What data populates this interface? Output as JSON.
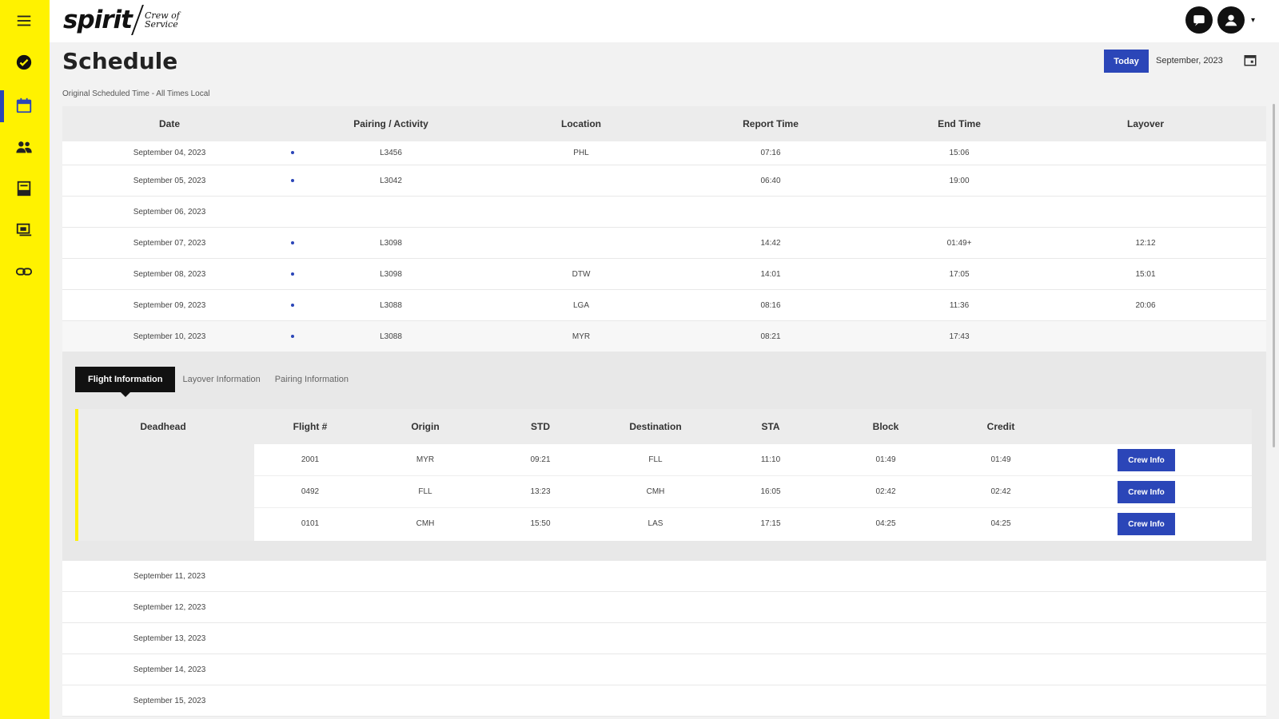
{
  "app": {
    "logo_word": "spirit",
    "logo_sub": "Crew of Service"
  },
  "page": {
    "title": "Schedule",
    "subnote": "Original Scheduled Time - All Times Local",
    "today_label": "Today",
    "month": "September, 2023"
  },
  "sidebar": {
    "icons": [
      "menu-icon",
      "check-circle-icon",
      "calendar-icon",
      "people-icon",
      "inbox-icon",
      "monitor-icon",
      "link-icon"
    ]
  },
  "table": {
    "headers": [
      "Date",
      "Pairing / Activity",
      "Location",
      "Report Time",
      "End Time",
      "Layover"
    ],
    "rows": [
      {
        "date": "September 04, 2023",
        "pairing": "L3456",
        "location": "PHL",
        "report": "07:16",
        "end": "15:06",
        "layover": ""
      },
      {
        "date": "September 05, 2023",
        "pairing": "L3042",
        "location": "",
        "report": "06:40",
        "end": "19:00",
        "layover": ""
      },
      {
        "date": "September 06, 2023",
        "pairing": "",
        "location": "",
        "report": "",
        "end": "",
        "layover": ""
      },
      {
        "date": "September 07, 2023",
        "pairing": "L3098",
        "location": "",
        "report": "14:42",
        "end": "01:49+",
        "layover": "12:12"
      },
      {
        "date": "September 08, 2023",
        "pairing": "L3098",
        "location": "DTW",
        "report": "14:01",
        "end": "17:05",
        "layover": "15:01"
      },
      {
        "date": "September 09, 2023",
        "pairing": "L3088",
        "location": "LGA",
        "report": "08:16",
        "end": "11:36",
        "layover": "20:06"
      },
      {
        "date": "September 10, 2023",
        "pairing": "L3088",
        "location": "MYR",
        "report": "08:21",
        "end": "17:43",
        "layover": ""
      }
    ],
    "rows_after": [
      {
        "date": "September 11, 2023"
      },
      {
        "date": "September 12, 2023"
      },
      {
        "date": "September 13, 2023"
      },
      {
        "date": "September 14, 2023"
      },
      {
        "date": "September 15, 2023"
      }
    ]
  },
  "detail": {
    "tabs": [
      "Flight Information",
      "Layover Information",
      "Pairing Information"
    ],
    "headers": [
      "Deadhead",
      "Flight #",
      "Origin",
      "STD",
      "Destination",
      "STA",
      "Block",
      "Credit"
    ],
    "crew_label": "Crew Info",
    "flights": [
      {
        "flight": "2001",
        "origin": "MYR",
        "std": "09:21",
        "dest": "FLL",
        "sta": "11:10",
        "block": "01:49",
        "credit": "01:49"
      },
      {
        "flight": "0492",
        "origin": "FLL",
        "std": "13:23",
        "dest": "CMH",
        "sta": "16:05",
        "block": "02:42",
        "credit": "02:42"
      },
      {
        "flight": "0101",
        "origin": "CMH",
        "std": "15:50",
        "dest": "LAS",
        "sta": "17:15",
        "block": "04:25",
        "credit": "04:25"
      }
    ]
  },
  "colors": {
    "sidebar": "#fff200",
    "accent": "#2b46b8"
  }
}
